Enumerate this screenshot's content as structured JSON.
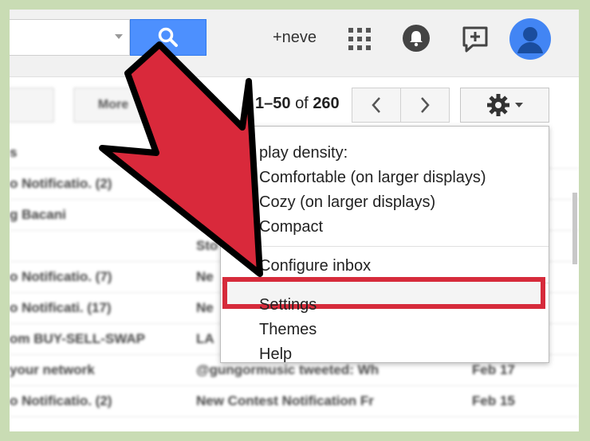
{
  "header": {
    "user_link": "+neve"
  },
  "toolbar": {
    "more_label": "More",
    "pager_range": "1–50",
    "pager_of": "of",
    "pager_total": "260"
  },
  "mail_rows": [
    {
      "sender": "s",
      "subject": "",
      "date": ""
    },
    {
      "sender": "o Notificatio. (2)",
      "subject": "",
      "date": ""
    },
    {
      "sender": "g Bacani",
      "subject": "",
      "date": ""
    },
    {
      "sender": "",
      "subject": "Sto",
      "date": ""
    },
    {
      "sender": "o Notificatio. (7)",
      "subject": "Ne",
      "date": ""
    },
    {
      "sender": "o Notificati. (17)",
      "subject": "Ne",
      "date": ""
    },
    {
      "sender": "om BUY-SELL-SWAP",
      "subject": "LA",
      "date": ""
    },
    {
      "sender": "your network",
      "subject": "@gungormusic tweeted: Wh",
      "date": "Feb 17"
    },
    {
      "sender": "o Notificatio. (2)",
      "subject": "New Contest Notification Fr",
      "date": "Feb 15"
    }
  ],
  "menu": {
    "section_label": "play density:",
    "items": [
      "Comfortable (on larger displays)",
      "Cozy (on larger displays)",
      "Compact"
    ],
    "configure_inbox": "Configure inbox",
    "settings": "Settings",
    "themes": "Themes",
    "help": "Help"
  },
  "colors": {
    "search_button": "#4d90fe",
    "highlight_border": "#d62b3b",
    "arrow_fill": "#d9293b",
    "avatar": "#4285f4"
  },
  "icons": [
    "search-icon",
    "apps-grid-icon",
    "notifications-bell-icon",
    "share-plus-icon",
    "avatar-icon",
    "chevron-left-icon",
    "chevron-right-icon",
    "gear-icon"
  ]
}
